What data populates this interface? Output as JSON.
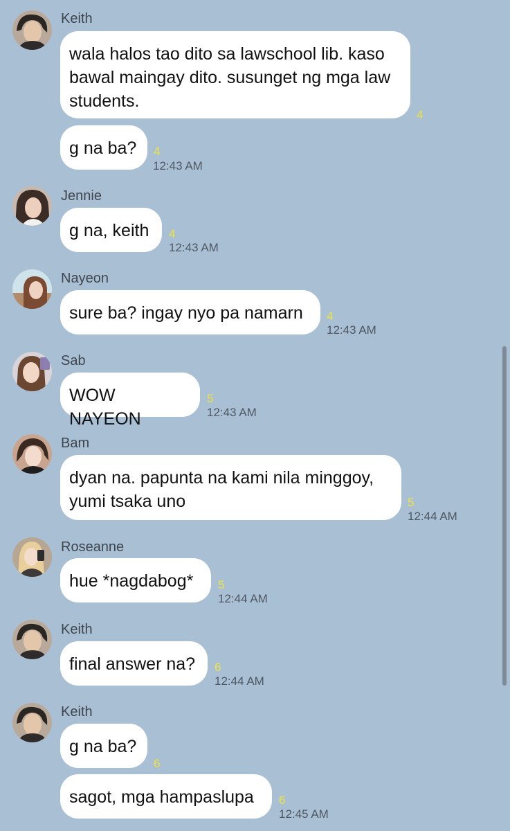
{
  "messages": [
    {
      "sender": "Keith",
      "avatar": "keith-avatar",
      "bubbles": [
        {
          "text": "wala halos tao dito sa lawschool lib. kaso bawal maingay dito. susunget ng mga law students.",
          "read": "4",
          "time": ""
        },
        {
          "text": "g na ba?",
          "read": "4",
          "time": "12:43 AM"
        }
      ]
    },
    {
      "sender": "Jennie",
      "avatar": "jennie-avatar",
      "bubbles": [
        {
          "text": "g na, keith",
          "read": "4",
          "time": "12:43 AM"
        }
      ]
    },
    {
      "sender": "Nayeon",
      "avatar": "nayeon-avatar",
      "bubbles": [
        {
          "text": "sure ba? ingay nyo pa namarn",
          "read": "4",
          "time": "12:43 AM"
        }
      ]
    },
    {
      "sender": "Sab",
      "avatar": "sab-avatar",
      "bubbles": [
        {
          "text": "WOW NAYEON",
          "read": "5",
          "time": "12:43 AM"
        }
      ]
    },
    {
      "sender": "Bam",
      "avatar": "bam-avatar",
      "bubbles": [
        {
          "text": "dyan na. papunta na kami nila minggoy, yumi tsaka uno",
          "read": "5",
          "time": "12:44 AM"
        }
      ]
    },
    {
      "sender": "Roseanne",
      "avatar": "roseanne-avatar",
      "bubbles": [
        {
          "text": "hue *nagdabog*",
          "read": "5",
          "time": "12:44 AM"
        }
      ]
    },
    {
      "sender": "Keith",
      "avatar": "keith-avatar",
      "bubbles": [
        {
          "text": "final answer na?",
          "read": "6",
          "time": "12:44 AM"
        }
      ]
    },
    {
      "sender": "Keith",
      "avatar": "keith-avatar",
      "bubbles": [
        {
          "text": "g na ba?",
          "read": "6",
          "time": ""
        },
        {
          "text": "sagot, mga hampaslupa",
          "read": "6",
          "time": "12:45 AM"
        }
      ]
    }
  ]
}
